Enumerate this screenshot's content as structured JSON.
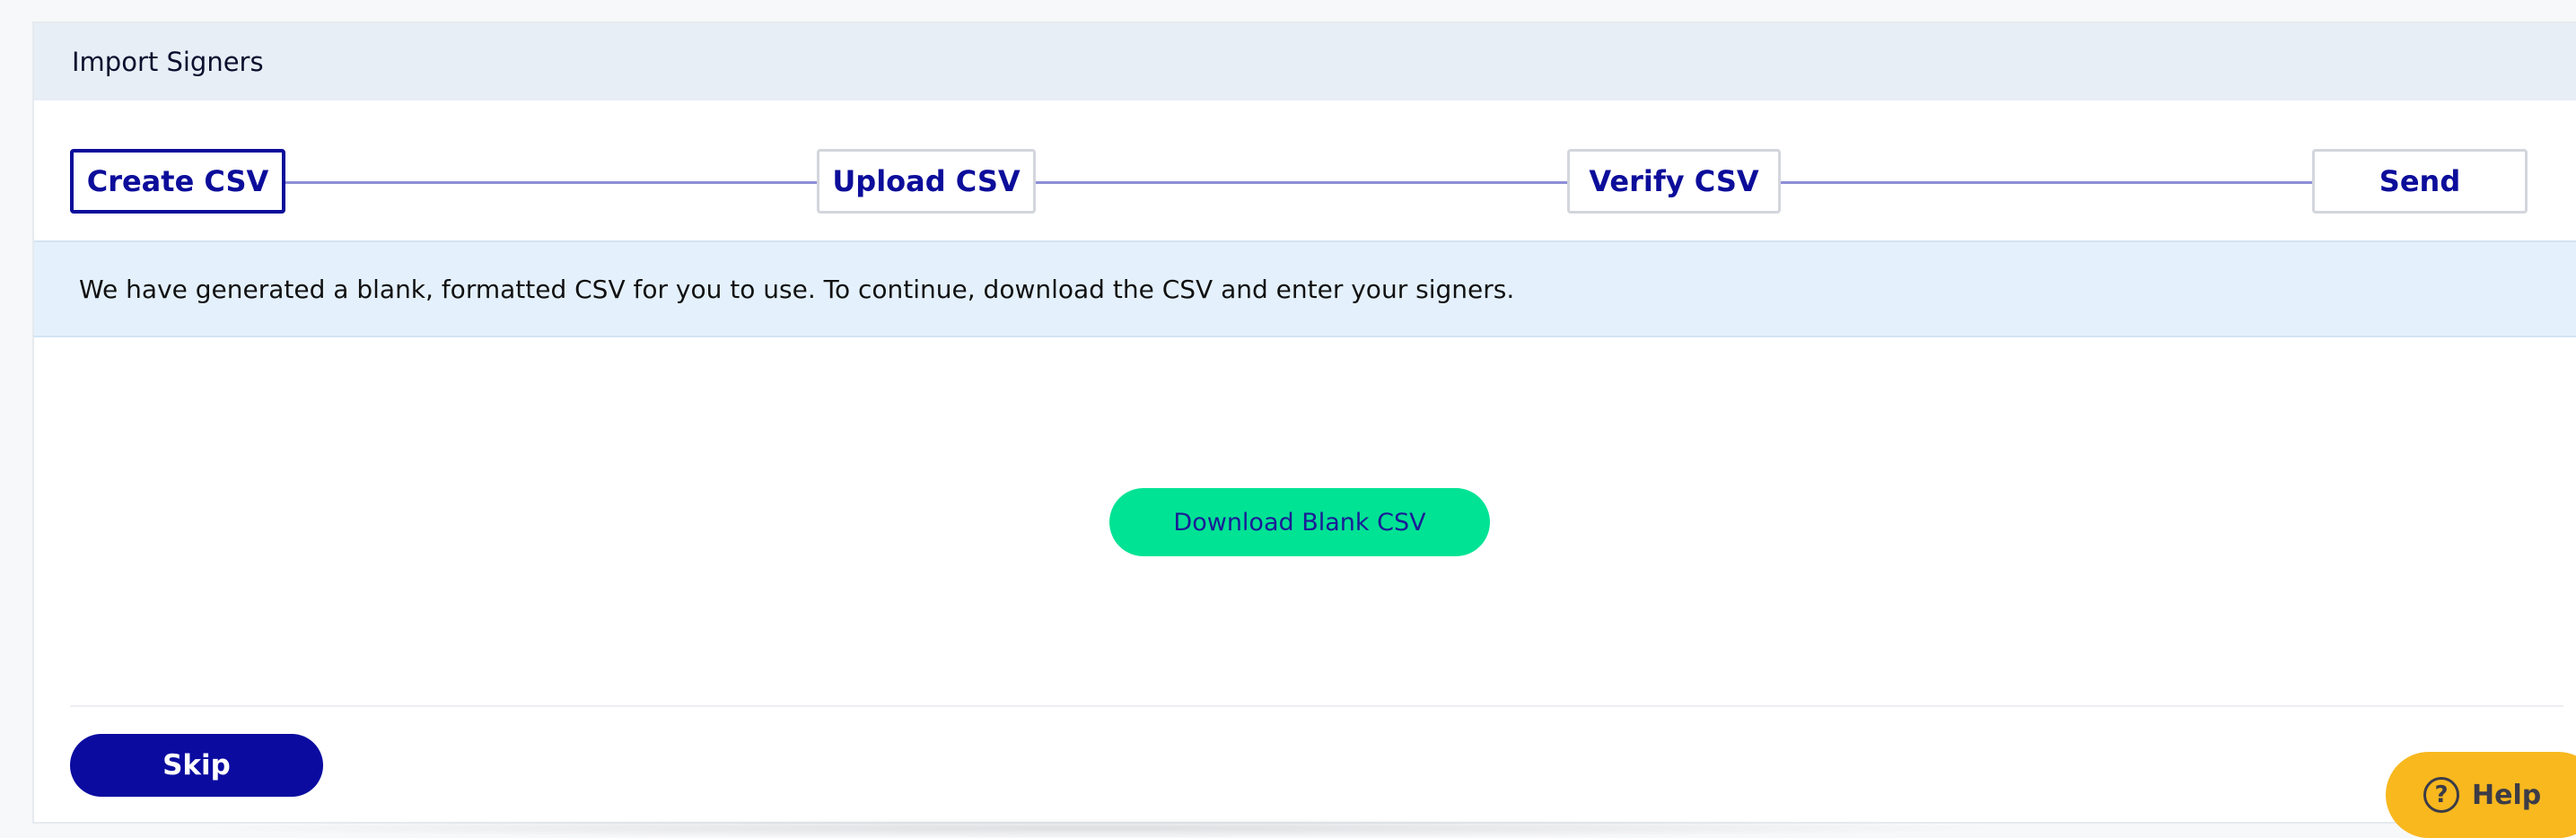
{
  "panel": {
    "title": "Import Signers"
  },
  "stepper": {
    "steps": [
      {
        "label": "Create CSV",
        "state": "active"
      },
      {
        "label": "Upload CSV",
        "state": "inactive"
      },
      {
        "label": "Verify CSV",
        "state": "inactive"
      },
      {
        "label": "Send",
        "state": "inactive"
      }
    ]
  },
  "info": {
    "message": "We have generated a blank, formatted CSV for you to use. To continue, download the CSV and enter your signers."
  },
  "actions": {
    "download_label": "Download Blank CSV",
    "skip_label": "Skip"
  },
  "help": {
    "icon": "question-circle-icon",
    "icon_glyph": "?",
    "label": "Help"
  },
  "colors": {
    "primary": "#0c0d9a",
    "accent_green": "#00e394",
    "help_yellow": "#f8b81e",
    "info_bg": "#e4f1fc",
    "header_bg": "#e8eef6"
  }
}
